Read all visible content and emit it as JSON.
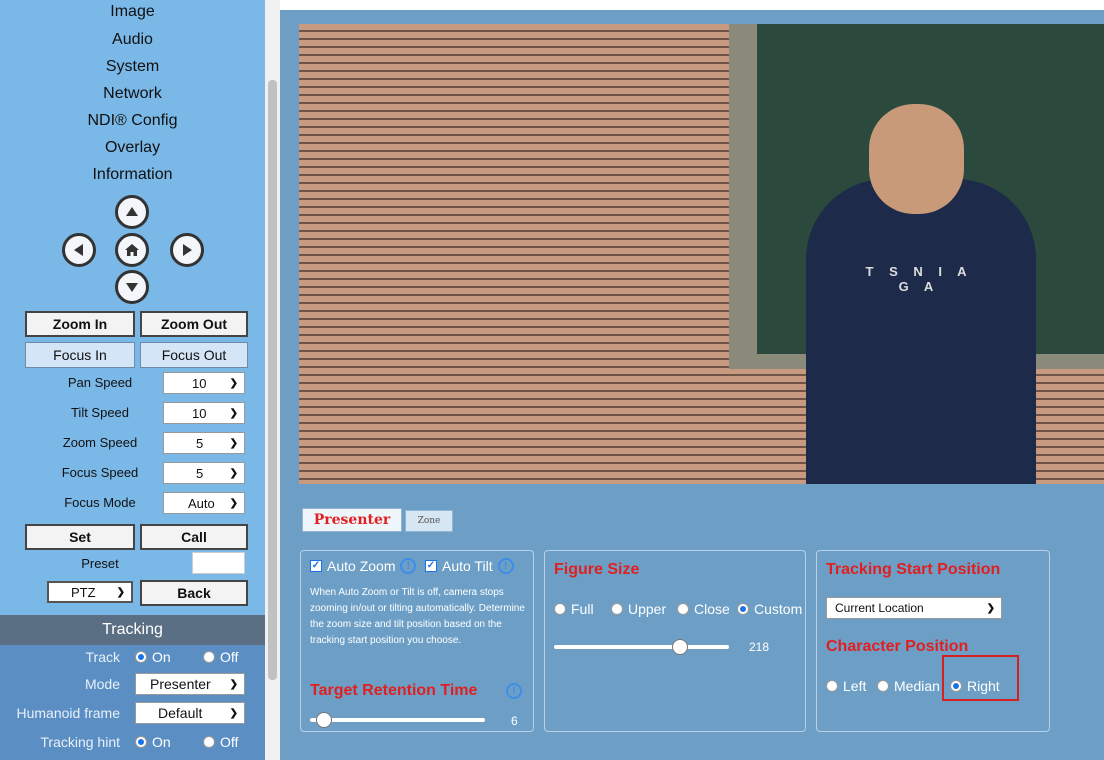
{
  "menu": {
    "items": [
      "Image",
      "Audio",
      "System",
      "Network",
      "NDI® Config",
      "Overlay",
      "Information"
    ]
  },
  "ptz_arrows": {
    "up_icon": "arrow-up",
    "down_icon": "arrow-down",
    "left_icon": "arrow-left",
    "right_icon": "arrow-right",
    "home_icon": "home"
  },
  "controls": {
    "zoom_in": "Zoom In",
    "zoom_out": "Zoom Out",
    "focus_in": "Focus In",
    "focus_out": "Focus Out",
    "pan_speed_label": "Pan Speed",
    "pan_speed_value": "10",
    "tilt_speed_label": "Tilt Speed",
    "tilt_speed_value": "10",
    "zoom_speed_label": "Zoom Speed",
    "zoom_speed_value": "5",
    "focus_speed_label": "Focus Speed",
    "focus_speed_value": "5",
    "focus_mode_label": "Focus Mode",
    "focus_mode_value": "Auto",
    "set": "Set",
    "call": "Call",
    "preset_label": "Preset",
    "preset_value": "",
    "ptz_value": "PTZ",
    "back": "Back"
  },
  "tracking": {
    "header": "Tracking",
    "track_label": "Track",
    "track_on": "On",
    "track_off": "Off",
    "mode_label": "Mode",
    "mode_value": "Presenter",
    "humanoid_label": "Humanoid frame",
    "humanoid_value": "Default",
    "hint_label": "Tracking hint",
    "hint_on": "On",
    "hint_off": "Off"
  },
  "video": {
    "shirt_text": "T S N I A G A"
  },
  "tabs": {
    "presenter": "Presenter",
    "zone": "Zone"
  },
  "auto_panel": {
    "auto_zoom": "Auto Zoom",
    "auto_tilt": "Auto Tilt",
    "description": "When Auto Zoom or Tilt is off, camera stops zooming in/out or tilting automatically. Determine the zoom size and tilt position based on the tracking start position you choose.",
    "retention_title": "Target Retention Time",
    "retention_value": "6",
    "retention_level": 0.08
  },
  "figure_panel": {
    "title": "Figure Size",
    "options": [
      "Full",
      "Upper",
      "Close",
      "Custom"
    ],
    "selected": "Custom",
    "size_value": "218",
    "size_level": 0.72
  },
  "start_panel": {
    "title": "Tracking Start Position",
    "location_value": "Current Location",
    "char_title": "Character Position",
    "positions": [
      "Left",
      "Median",
      "Right"
    ],
    "selected": "Right"
  },
  "colors": {
    "accent_red": "#e02020",
    "sidebar_blue": "#7ab8e8",
    "main_blue": "#6d9fc6"
  }
}
